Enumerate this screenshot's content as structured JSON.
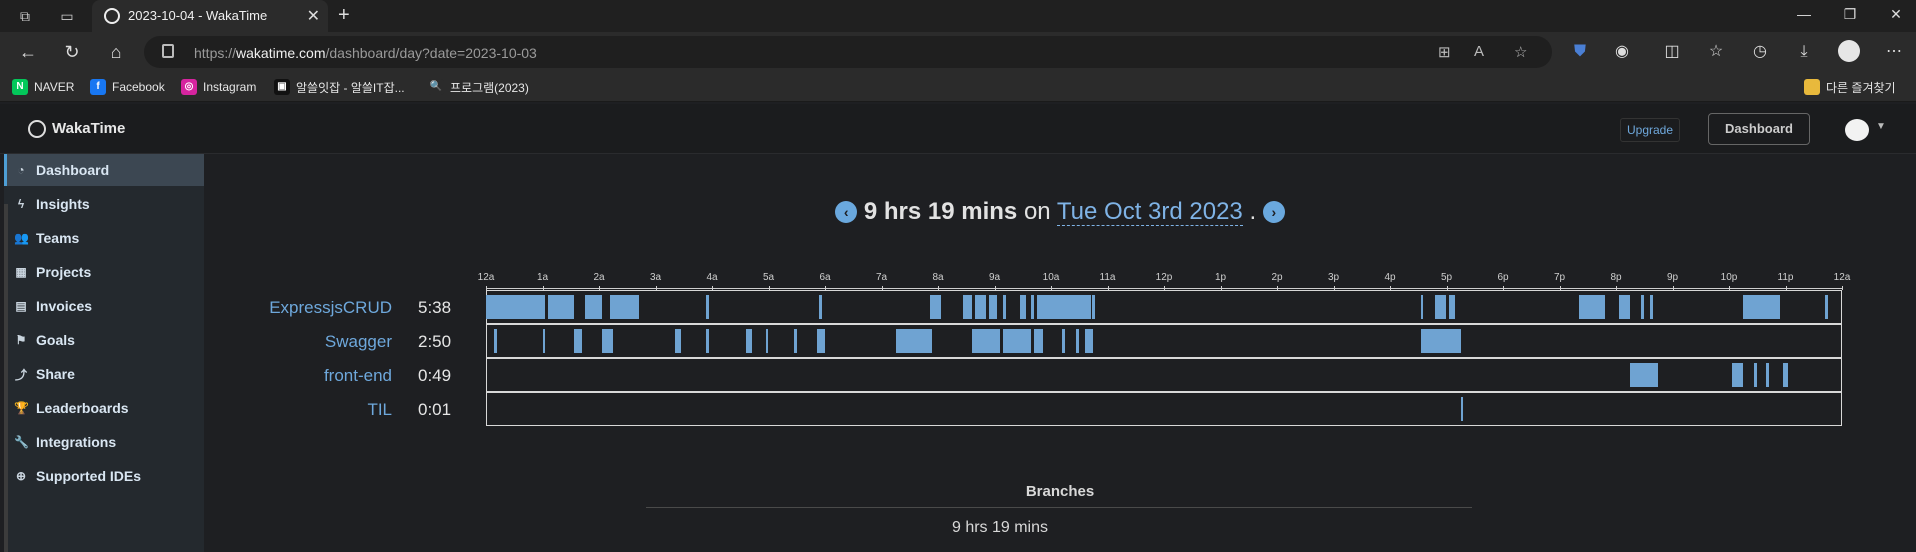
{
  "browser": {
    "tab_title": "2023-10-04 - WakaTime",
    "url_prefix": "https://",
    "url_domain": "wakatime.com",
    "url_path": "/dashboard/day?date=2023-10-03",
    "bookmarks": [
      {
        "label": "NAVER",
        "icon": "naver-icon",
        "color": "#03c75a",
        "glyph": "N"
      },
      {
        "label": "Facebook",
        "icon": "facebook-icon",
        "color": "#1877f2",
        "glyph": "f"
      },
      {
        "label": "Instagram",
        "icon": "instagram-icon",
        "color": "#d6249f",
        "glyph": "◎"
      },
      {
        "label": "알쓸잇잡 - 알쓸IT잡...",
        "icon": "site-icon",
        "color": "#111111",
        "glyph": "▣"
      },
      {
        "label": "프로그램(2023)",
        "icon": "search-icon",
        "color": "#2b2b2b",
        "glyph": "🔍"
      }
    ],
    "other_bookmarks": "다른 즐겨찾기"
  },
  "app": {
    "brand": "WakaTime",
    "upgrade_label": "Upgrade",
    "dashboard_label": "Dashboard"
  },
  "sidebar": {
    "items": [
      {
        "label": "Dashboard",
        "icon": "dashboard-icon",
        "glyph": "◔",
        "active": true
      },
      {
        "label": "Insights",
        "icon": "bolt-icon",
        "glyph": "ϟ",
        "active": false
      },
      {
        "label": "Teams",
        "icon": "users-icon",
        "glyph": "👥",
        "active": false
      },
      {
        "label": "Projects",
        "icon": "grid-icon",
        "glyph": "▦",
        "active": false
      },
      {
        "label": "Invoices",
        "icon": "document-icon",
        "glyph": "▤",
        "active": false
      },
      {
        "label": "Goals",
        "icon": "flag-icon",
        "glyph": "⚑",
        "active": false
      },
      {
        "label": "Share",
        "icon": "share-icon",
        "glyph": "⤴",
        "active": false
      },
      {
        "label": "Leaderboards",
        "icon": "trophy-icon",
        "glyph": "🏆",
        "active": false
      },
      {
        "label": "Integrations",
        "icon": "wrench-icon",
        "glyph": "🔧",
        "active": false
      },
      {
        "label": "Supported IDEs",
        "icon": "plus-circle-icon",
        "glyph": "⊕",
        "active": false
      }
    ]
  },
  "summary": {
    "total": "9 hrs 19 mins",
    "on": "on",
    "date": "Tue Oct 3rd 2023",
    "period": "."
  },
  "chart_data": {
    "type": "timeline",
    "x_ticks": [
      "12a",
      "1a",
      "2a",
      "3a",
      "4a",
      "5a",
      "6a",
      "7a",
      "8a",
      "9a",
      "10a",
      "11a",
      "12p",
      "1p",
      "2p",
      "3p",
      "4p",
      "5p",
      "6p",
      "7p",
      "8p",
      "9p",
      "10p",
      "11p",
      "12a"
    ],
    "x_range_hours": [
      0,
      24
    ],
    "bar_color": "#6fa3d2",
    "projects": [
      {
        "name": "ExpressjsCRUD",
        "duration": "5:38",
        "segments": [
          [
            0.0,
            0.45
          ],
          [
            0.45,
            1.05
          ],
          [
            1.1,
            1.55
          ],
          [
            1.75,
            2.05
          ],
          [
            2.2,
            2.7
          ],
          [
            3.9,
            3.95
          ],
          [
            5.9,
            5.95
          ],
          [
            7.85,
            8.05
          ],
          [
            8.45,
            8.6
          ],
          [
            8.65,
            8.85
          ],
          [
            8.9,
            9.05
          ],
          [
            9.15,
            9.2
          ],
          [
            9.45,
            9.55
          ],
          [
            9.65,
            9.7
          ],
          [
            9.75,
            10.7
          ],
          [
            10.72,
            10.78
          ],
          [
            16.55,
            16.58
          ],
          [
            16.8,
            17.0
          ],
          [
            17.05,
            17.15
          ],
          [
            19.35,
            19.8
          ],
          [
            20.05,
            20.25
          ],
          [
            20.45,
            20.5
          ],
          [
            20.6,
            20.65
          ],
          [
            22.25,
            22.9
          ],
          [
            23.7,
            23.75
          ]
        ]
      },
      {
        "name": "Swagger",
        "duration": "2:50",
        "segments": [
          [
            0.15,
            0.2
          ],
          [
            1.0,
            1.05
          ],
          [
            1.55,
            1.7
          ],
          [
            2.05,
            2.25
          ],
          [
            3.35,
            3.45
          ],
          [
            3.9,
            3.95
          ],
          [
            4.6,
            4.7
          ],
          [
            4.95,
            5.0
          ],
          [
            5.45,
            5.5
          ],
          [
            5.85,
            6.0
          ],
          [
            7.25,
            7.9
          ],
          [
            8.6,
            9.1
          ],
          [
            9.15,
            9.65
          ],
          [
            9.7,
            9.85
          ],
          [
            10.2,
            10.25
          ],
          [
            10.45,
            10.5
          ],
          [
            10.6,
            10.75
          ],
          [
            16.55,
            17.25
          ]
        ]
      },
      {
        "name": "front-end",
        "duration": "0:49",
        "segments": [
          [
            20.25,
            20.75
          ],
          [
            22.05,
            22.25
          ],
          [
            22.45,
            22.5
          ],
          [
            22.65,
            22.7
          ],
          [
            22.95,
            23.05
          ]
        ]
      },
      {
        "name": "TIL",
        "duration": "0:01",
        "segments": [
          [
            17.25,
            17.28
          ]
        ]
      }
    ]
  },
  "branches": {
    "title": "Branches",
    "total": "9 hrs 19 mins"
  }
}
